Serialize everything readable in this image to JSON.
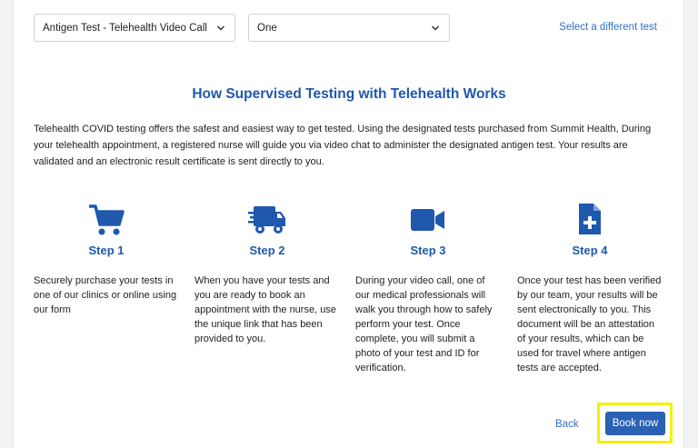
{
  "test_select": {
    "value": "Antigen Test - Telehealth Video Call"
  },
  "quantity_select": {
    "value": "One"
  },
  "select_different_test": "Select a different test",
  "heading": "How Supervised Testing with Telehealth Works",
  "intro": "Telehealth COVID testing offers the safest and easiest way to get tested. Using the designated tests purchased from Summit Health, During your telehealth appointment, a registered nurse will guide you via video chat to administer the designated antigen test. Your results are validated and an electronic result certificate is sent directly to you.",
  "steps": [
    {
      "icon": "shopping-cart-icon",
      "title": "Step 1",
      "text": "Securely purchase your tests in one of our clinics or online using our form"
    },
    {
      "icon": "delivery-truck-icon",
      "title": "Step 2",
      "text": "When you have your tests and you are ready to book an appointment with the nurse, use the unique link that has been provided to you."
    },
    {
      "icon": "video-camera-icon",
      "title": "Step 3",
      "text": "During your video call, one of our medical professionals will walk you through how to safely perform your test. Once complete, you will submit a photo of your test and ID for verification."
    },
    {
      "icon": "medical-file-icon",
      "title": "Step 4",
      "text": "Once your test has been verified by our team, your results will be sent electronically to you. This document will be an attestation of your results, which can be used for travel where antigen tests are accepted."
    }
  ],
  "back_label": "Back",
  "book_label": "Book now",
  "colors": {
    "accent": "#1f58ad",
    "link": "#2f6fc9",
    "button": "#2a61b3",
    "highlight": "#f4f000"
  }
}
